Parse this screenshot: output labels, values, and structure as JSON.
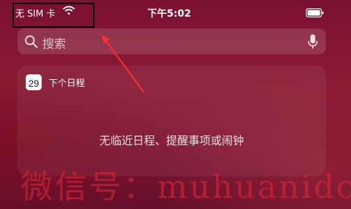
{
  "status_bar": {
    "carrier": "无 SIM 卡",
    "wifi_icon": "wifi-icon",
    "time": "下午5:02",
    "battery_icon": "battery-icon"
  },
  "search": {
    "placeholder": "搜索",
    "search_icon": "search-icon",
    "mic_icon": "mic-icon"
  },
  "calendar_widget": {
    "icon_day": "29",
    "title": "下个日程",
    "empty_message": "无临近日程、提醒事项或闹钟"
  },
  "watermark": "微信号：muhuanidc",
  "colors": {
    "background": "#7a1030",
    "annotation": "#ff3030",
    "watermark": "#e6283c"
  }
}
